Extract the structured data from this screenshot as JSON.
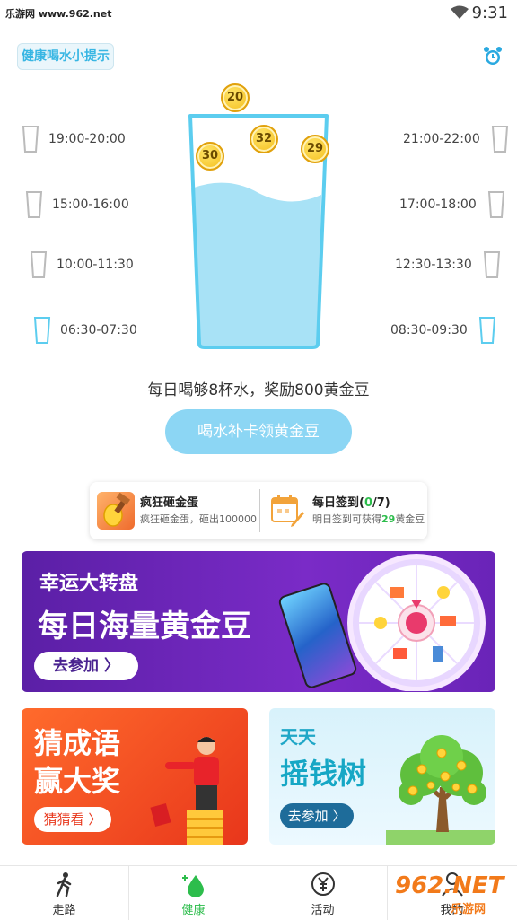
{
  "status": {
    "left": "乐游网 www.962.net",
    "time": "9:31"
  },
  "header": {
    "tip_button": "健康喝水小提示"
  },
  "slots": {
    "left": [
      "19:00-20:00",
      "15:00-16:00",
      "10:00-11:30",
      "06:30-07:30"
    ],
    "right": [
      "21:00-22:00",
      "17:00-18:00",
      "12:30-13:30",
      "08:30-09:30"
    ]
  },
  "coins": [
    "20",
    "32",
    "30",
    "29"
  ],
  "reward": {
    "text": "每日喝够8杯水，奖励800黄金豆",
    "button": "喝水补卡领黄金豆"
  },
  "tasks": {
    "egg_title": "疯狂砸金蛋",
    "egg_sub": "疯狂砸金蛋，砸出100000",
    "sign_title": "每日签到(",
    "sign_done": "0",
    "sign_total": "/7)",
    "sign_sub_prefix": "明日签到可获得",
    "sign_sub_num": "29",
    "sign_sub_suffix": "黄金豆"
  },
  "banners": {
    "wheel_title": "幸运大转盘",
    "wheel_main": "每日海量黄金豆",
    "wheel_btn": "去参加 〉",
    "idiom_l1": "猜成语",
    "idiom_l2": "赢大奖",
    "idiom_btn": "猜猜看 〉",
    "tree_l1": "天天",
    "tree_l2": "摇钱树",
    "tree_btn": "去参加 〉"
  },
  "tabs": [
    "走路",
    "健康",
    "活动",
    "我的"
  ],
  "watermark": {
    "main": "962.NET",
    "sub": "乐游网"
  },
  "colors": {
    "accent_green": "#2dbd4c",
    "water_blue": "#a8e2f6",
    "button_blue": "#8cd6f4"
  }
}
